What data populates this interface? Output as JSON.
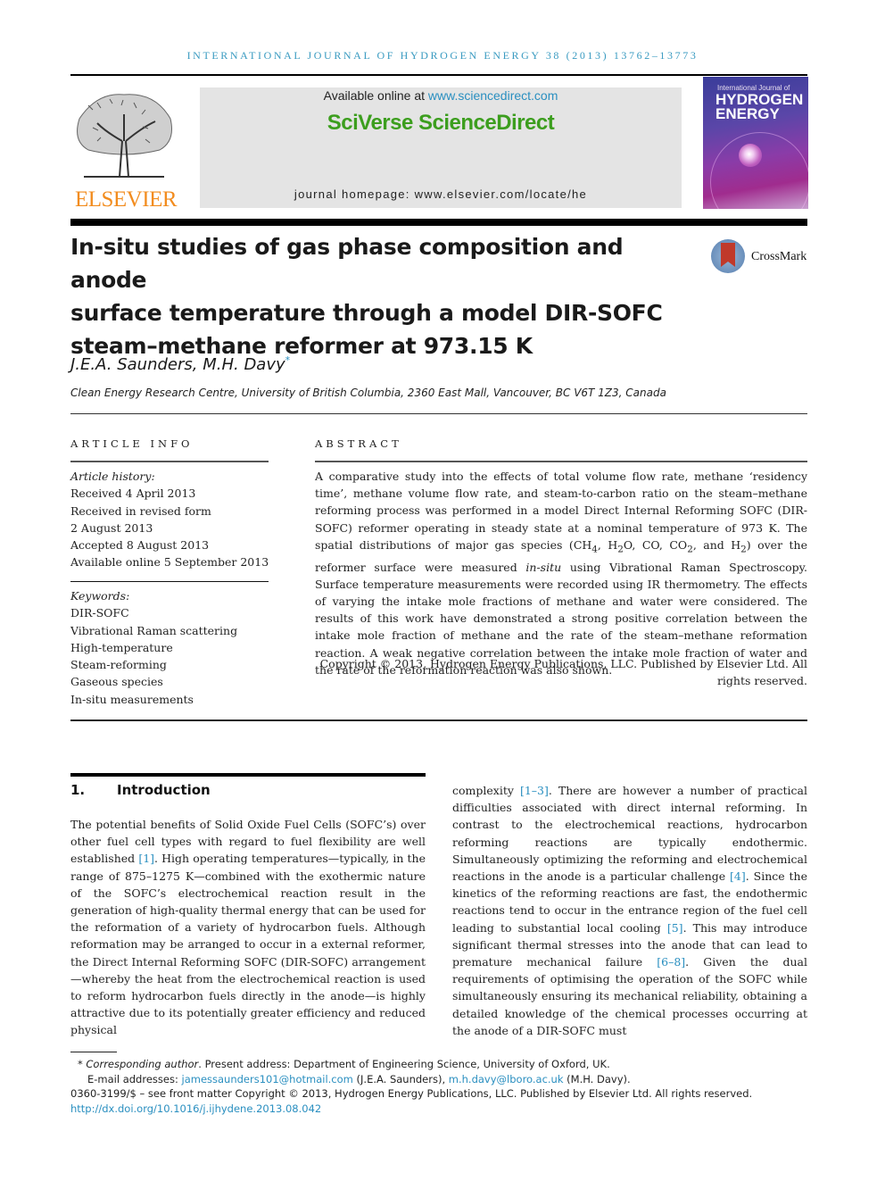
{
  "running_head": "INTERNATIONAL JOURNAL OF HYDROGEN ENERGY 38 (2013) 13762–13773",
  "header": {
    "publisher_logo_text": "ELSEVIER",
    "available_online_prefix": "Available online at ",
    "available_online_link": "www.sciencedirect.com",
    "platform_name": "SciVerse ScienceDirect",
    "journal_homepage": "journal homepage: www.elsevier.com/locate/he",
    "cover": {
      "line1": "International Journal of",
      "line2": "HYDROGEN",
      "line3": "ENERGY"
    },
    "colors": {
      "running_head": "#3a9bc1",
      "elsevier": "#f28c1e",
      "sciverse": "#3c9e1e",
      "link": "#2a8fc0"
    }
  },
  "article": {
    "title_lines": [
      "In-situ studies of gas phase composition and anode",
      "surface temperature through a model DIR-SOFC",
      "steam–methane reformer at 973.15 K"
    ],
    "crossmark_label": "CrossMark",
    "authors": "J.E.A. Saunders, M.H. Davy",
    "author_mark": "*",
    "affiliation": "Clean Energy Research Centre, University of British Columbia, 2360 East Mall, Vancouver, BC V6T 1Z3, Canada"
  },
  "article_info": {
    "heading": "ARTICLE INFO",
    "history_label": "Article history:",
    "history": [
      "Received 4 April 2013",
      "Received in revised form",
      "2 August 2013",
      "Accepted 8 August 2013",
      "Available online 5 September 2013"
    ],
    "keywords_label": "Keywords:",
    "keywords": [
      "DIR-SOFC",
      "Vibrational Raman scattering",
      "High-temperature",
      "Steam-reforming",
      "Gaseous species",
      "In-situ measurements"
    ]
  },
  "abstract": {
    "heading": "ABSTRACT",
    "p1": "A comparative study into the effects of total volume flow rate, methane ‘residency time’, methane volume flow rate, and steam-to-carbon ratio on the steam–methane reforming process was performed in a model Direct Internal Reforming SOFC (DIR-SOFC) reformer operating in steady state at a nominal temperature of 973 K. The spatial distributions of major gas species (",
    "species": [
      "CH",
      "4",
      "H",
      "2",
      "O, CO, CO",
      "2",
      ", and H",
      "2"
    ],
    "p2": ") over the reformer surface were measured ",
    "in_situ": "in-situ",
    "p3": " using Vibrational Raman Spectroscopy. Surface temperature measurements were recorded using IR thermometry. The effects of varying the intake mole fractions of methane and water were considered. The results of this work have demonstrated a strong positive correlation between the intake mole fraction of methane and the rate of the steam–methane reformation reaction. A weak negative correlation between the intake mole fraction of water and the rate of the reformation reaction was also shown.",
    "copyright": "Copyright © 2013, Hydrogen Energy Publications, LLC. Published by Elsevier Ltd. All rights reserved."
  },
  "introduction": {
    "number": "1.",
    "heading": "Introduction",
    "left": [
      {
        "t": "The potential benefits of Solid Oxide Fuel Cells (SOFC’s) over other fuel cell types with regard to fuel flexibility are well established "
      },
      {
        "r": "[1]"
      },
      {
        "t": ". High operating temperatures—typically, in the range of 875–1275 K—combined with the exothermic nature of the SOFC’s electrochemical reaction result in the generation of high-quality thermal energy that can be used for the reformation of a variety of hydrocarbon fuels. Although reformation may be arranged to occur in a external reformer, the Direct Internal Reforming SOFC (DIR-SOFC) arrangement—whereby the heat from the electrochemical reaction is used to reform hydrocarbon fuels directly in the anode—is highly attractive due to its potentially greater efficiency and reduced physical"
      }
    ],
    "right": [
      {
        "t": "complexity "
      },
      {
        "r": "[1–3]"
      },
      {
        "t": ". There are however a number of practical difficulties associated with direct internal reforming. In contrast to the electrochemical reactions, hydrocarbon reforming reactions are typically endothermic. Simultaneously optimizing the reforming and electrochemical reactions in the anode is a particular challenge "
      },
      {
        "r": "[4]"
      },
      {
        "t": ". Since the kinetics of the reforming reactions are fast, the endothermic reactions tend to occur in the entrance region of the fuel cell leading to substantial local cooling "
      },
      {
        "r": "[5]"
      },
      {
        "t": ". This may introduce significant thermal stresses into the anode that can lead to premature mechanical failure "
      },
      {
        "r": "[6–8]"
      },
      {
        "t": ". Given the dual requirements of optimising the operation of the SOFC while simultaneously ensuring its mechanical reliability, obtaining a detailed knowledge of the chemical processes occurring at the anode of a DIR-SOFC must"
      }
    ]
  },
  "footnotes": {
    "mark": "*",
    "corresponding_label": "Corresponding author",
    "corresponding_text": ". Present address: Department of Engineering Science, University of Oxford, UK.",
    "email_label": "E-mail addresses: ",
    "email1": "jamessaunders101@hotmail.com",
    "email1_owner": " (J.E.A. Saunders), ",
    "email2": "m.h.davy@lboro.ac.uk",
    "email2_owner": " (M.H. Davy).",
    "front_matter": "0360-3199/$ – see front matter Copyright © 2013, Hydrogen Energy Publications, LLC. Published by Elsevier Ltd. All rights reserved.",
    "doi": "http://dx.doi.org/10.1016/j.ijhydene.2013.08.042"
  }
}
